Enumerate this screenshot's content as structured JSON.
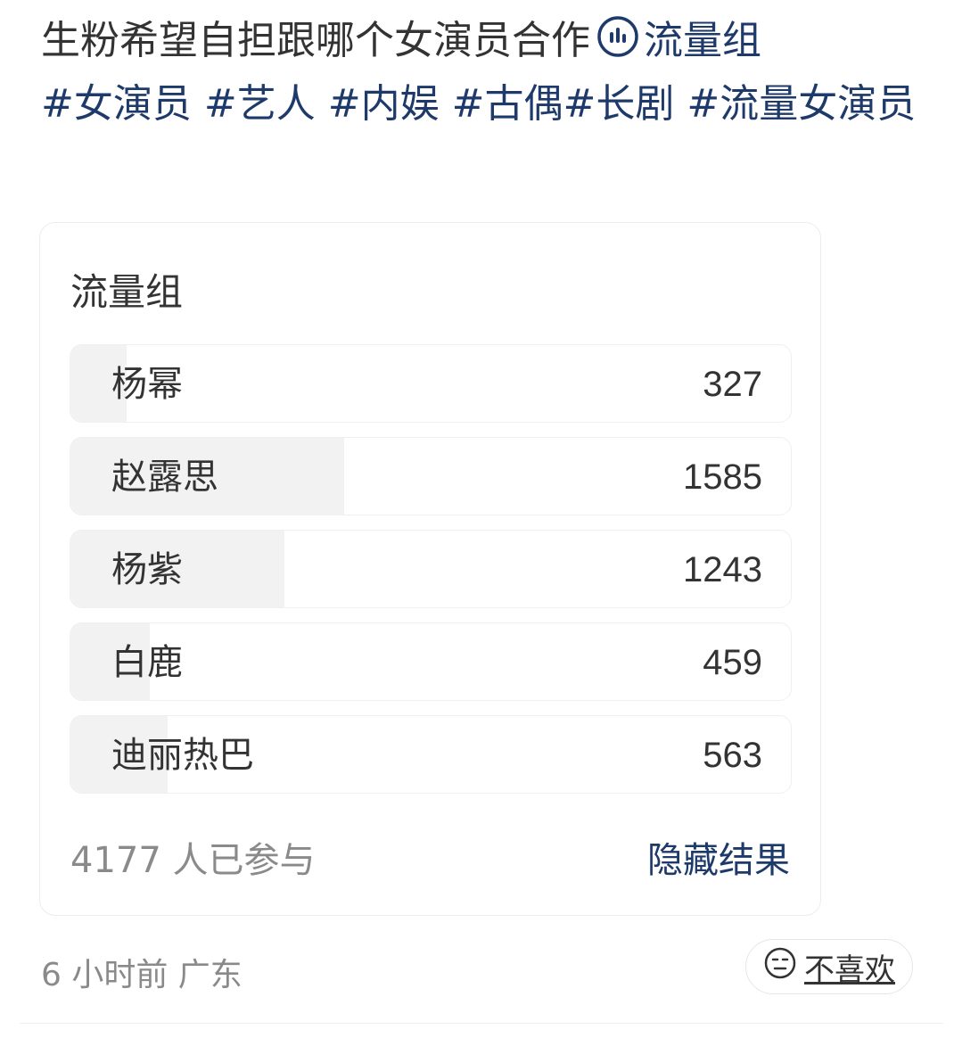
{
  "post": {
    "text": "生粉希望自担跟哪个女演员合作",
    "poll_link": "流量组",
    "tags": [
      "#女演员",
      "#艺人",
      "#内娱",
      "#古偶",
      "#长剧",
      "#流量女演员"
    ]
  },
  "poll": {
    "title": "流量组",
    "options": [
      {
        "label": "杨幂",
        "count": "327",
        "fraction": 0.0783
      },
      {
        "label": "赵露思",
        "count": "1585",
        "fraction": 0.3795
      },
      {
        "label": "杨紫",
        "count": "1243",
        "fraction": 0.2976
      },
      {
        "label": "白鹿",
        "count": "459",
        "fraction": 0.1099
      },
      {
        "label": "迪丽热巴",
        "count": "563",
        "fraction": 0.1348
      }
    ],
    "participants": "4177 人已参与",
    "hide_results_label": "隐藏结果"
  },
  "meta": {
    "time_location": "6 小时前 广东",
    "dislike_label": "不喜欢"
  },
  "icons": {
    "poll": "poll-chart-icon",
    "dislike": "neutral-face-icon"
  },
  "colors": {
    "link": "#1d3a6b",
    "text": "#333333",
    "muted": "#8a8a8a",
    "bar_fill": "#f2f2f2"
  }
}
